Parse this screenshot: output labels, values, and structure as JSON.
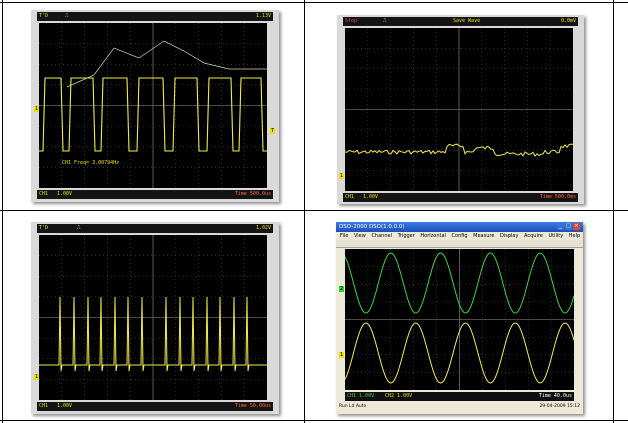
{
  "panels": [
    {
      "id": "top-left",
      "top_bar": {
        "run_state": "T'D",
        "trigger_label": "",
        "level": "1.13V"
      },
      "bottom_bar": {
        "channel": "CH1",
        "volts_div": "1.00V",
        "timebase": "Time 500.0us"
      },
      "measurement": "CH1 Freq= 3.00794Hz",
      "markers": {
        "channel": "1",
        "trigger": "T"
      }
    },
    {
      "id": "top-right",
      "top_bar": {
        "run_state": "Stop",
        "trigger_label": "Save Wave",
        "level": "0.0mV"
      },
      "bottom_bar": {
        "channel": "CH1",
        "volts_div": "1.00V",
        "timebase": "Time 500.0ms"
      },
      "markers": {
        "channel": "1"
      }
    },
    {
      "id": "bottom-left",
      "top_bar": {
        "run_state": "T'D",
        "trigger_label": "",
        "level": "1.02V"
      },
      "bottom_bar": {
        "channel": "CH1",
        "volts_div": "1.00V",
        "timebase": "Time 50.00us"
      },
      "markers": {
        "channel": "1"
      }
    },
    {
      "id": "bottom-right",
      "window_title": "DSO-2000 DSO(1.0.0.0)",
      "menu": [
        "File",
        "View",
        "Channel",
        "Trigger",
        "Horizontal",
        "Config",
        "Measure",
        "Display",
        "Acquire",
        "Utility",
        "Help"
      ],
      "bottom_bar": {
        "ch1": "CH1 1.00V",
        "ch2": "CH2 1.00V",
        "timebase": "Time 40.0us"
      },
      "status_left": "Run Ld Auto",
      "status_right": "29-04-2009 15:12",
      "markers": {
        "ch1": "1",
        "ch2": "2"
      }
    }
  ],
  "colors": {
    "trace_yellow": "#f2ec4a",
    "trace_green": "#3cd23c",
    "grid": "#5a5a5a",
    "screen": "#000000"
  }
}
